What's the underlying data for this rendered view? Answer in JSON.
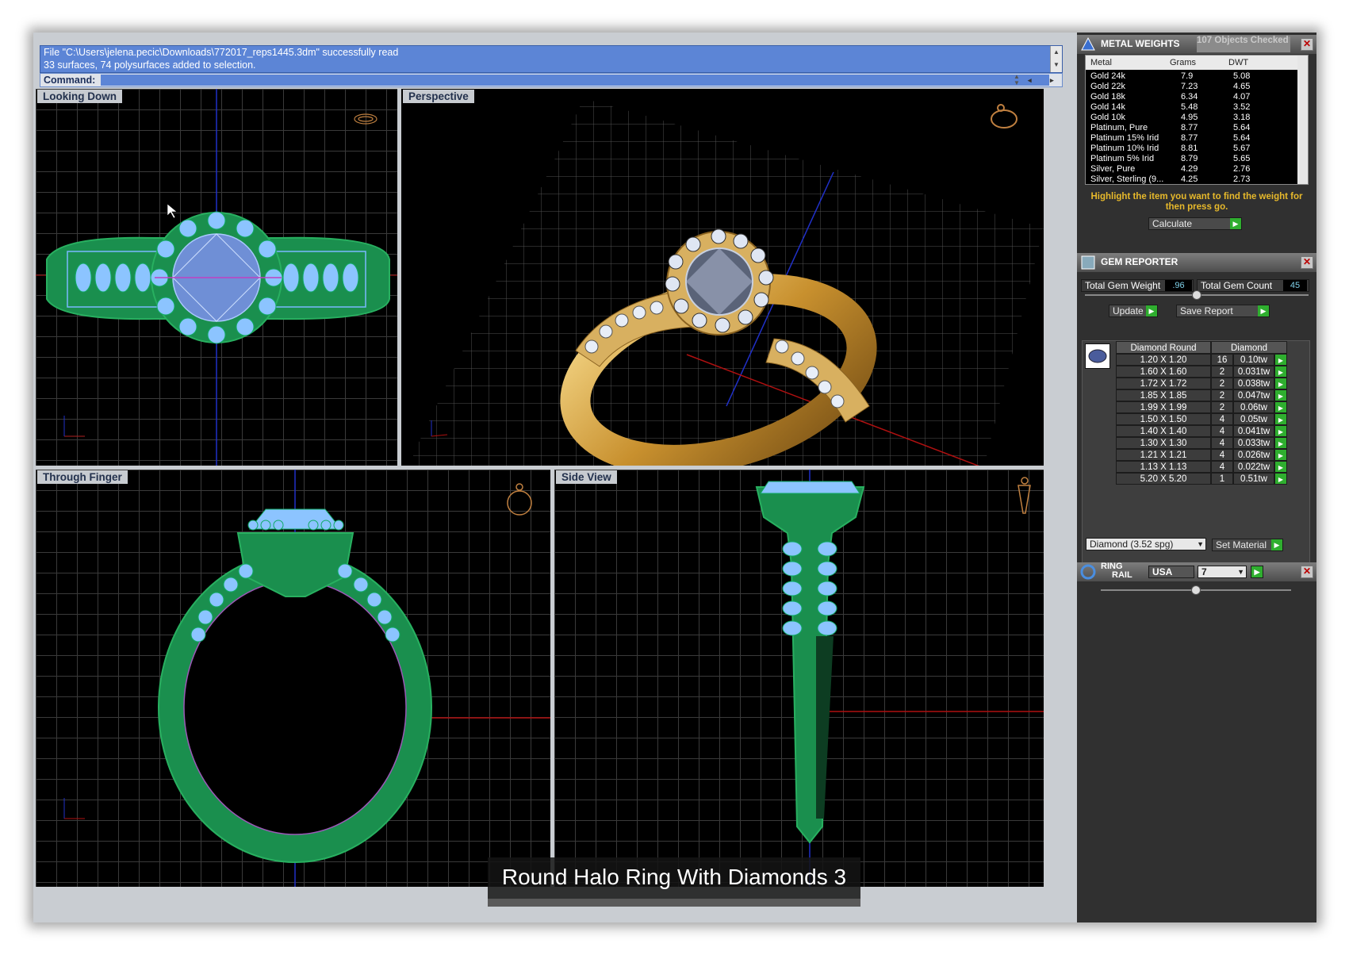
{
  "command": {
    "history": [
      "File \"C:\\Users\\jelena.pecic\\Downloads\\772017_reps1445.3dm\" successfully read",
      "33 surfaces, 74 polysurfaces added to selection."
    ],
    "prompt_label": "Command:"
  },
  "viewports": {
    "top_left": "Looking Down",
    "top_right": "Perspective",
    "bottom_left": "Through Finger",
    "bottom_right": "Side View"
  },
  "metal_weights": {
    "title": "METAL WEIGHTS",
    "objects_checked": "107 Objects Checked",
    "columns": [
      "Metal",
      "Grams",
      "DWT"
    ],
    "rows": [
      [
        "Gold 24k",
        "7.9",
        "5.08"
      ],
      [
        "Gold 22k",
        "7.23",
        "4.65"
      ],
      [
        "Gold 18k",
        "6.34",
        "4.07"
      ],
      [
        "Gold 14k",
        "5.48",
        "3.52"
      ],
      [
        "Gold 10k",
        "4.95",
        "3.18"
      ],
      [
        "Platinum, Pure",
        "8.77",
        "5.64"
      ],
      [
        "Platinum 15% Irid",
        "8.77",
        "5.64"
      ],
      [
        "Platinum 10% Irid",
        "8.81",
        "5.67"
      ],
      [
        "Platinum 5% Irid",
        "8.79",
        "5.65"
      ],
      [
        "Silver, Pure",
        "4.29",
        "2.76"
      ],
      [
        "Silver, Sterling (9...",
        "4.25",
        "2.73"
      ]
    ],
    "hint": "Highlight the item you want to find the weight for then press go.",
    "calculate_label": "Calculate"
  },
  "gem_reporter": {
    "title": "GEM REPORTER",
    "total_weight_label": "Total Gem Weight",
    "total_weight_value": ".96",
    "total_count_label": "Total Gem Count",
    "total_count_value": "45",
    "update_label": "Update",
    "save_report_label": "Save Report",
    "columns": [
      "Diamond Round",
      "Diamond"
    ],
    "rows": [
      [
        "1.20 X 1.20",
        "16",
        "0.10tw"
      ],
      [
        "1.60 X 1.60",
        "2",
        "0.031tw"
      ],
      [
        "1.72 X 1.72",
        "2",
        "0.038tw"
      ],
      [
        "1.85 X 1.85",
        "2",
        "0.047tw"
      ],
      [
        "1.99 X 1.99",
        "2",
        "0.06tw"
      ],
      [
        "1.50 X 1.50",
        "4",
        "0.05tw"
      ],
      [
        "1.40 X 1.40",
        "4",
        "0.041tw"
      ],
      [
        "1.30 X 1.30",
        "4",
        "0.033tw"
      ],
      [
        "1.21 X 1.21",
        "4",
        "0.026tw"
      ],
      [
        "1.13 X 1.13",
        "4",
        "0.022tw"
      ],
      [
        "5.20 X 5.20",
        "1",
        "0.51tw"
      ]
    ],
    "material_value": "Diamond    (3.52 spg)",
    "set_material_label": "Set Material"
  },
  "ring_rail": {
    "title_line1": "RING",
    "title_line2": "RAIL",
    "country": "USA",
    "size": "7"
  },
  "caption": "Round Halo Ring With Diamonds 3"
}
